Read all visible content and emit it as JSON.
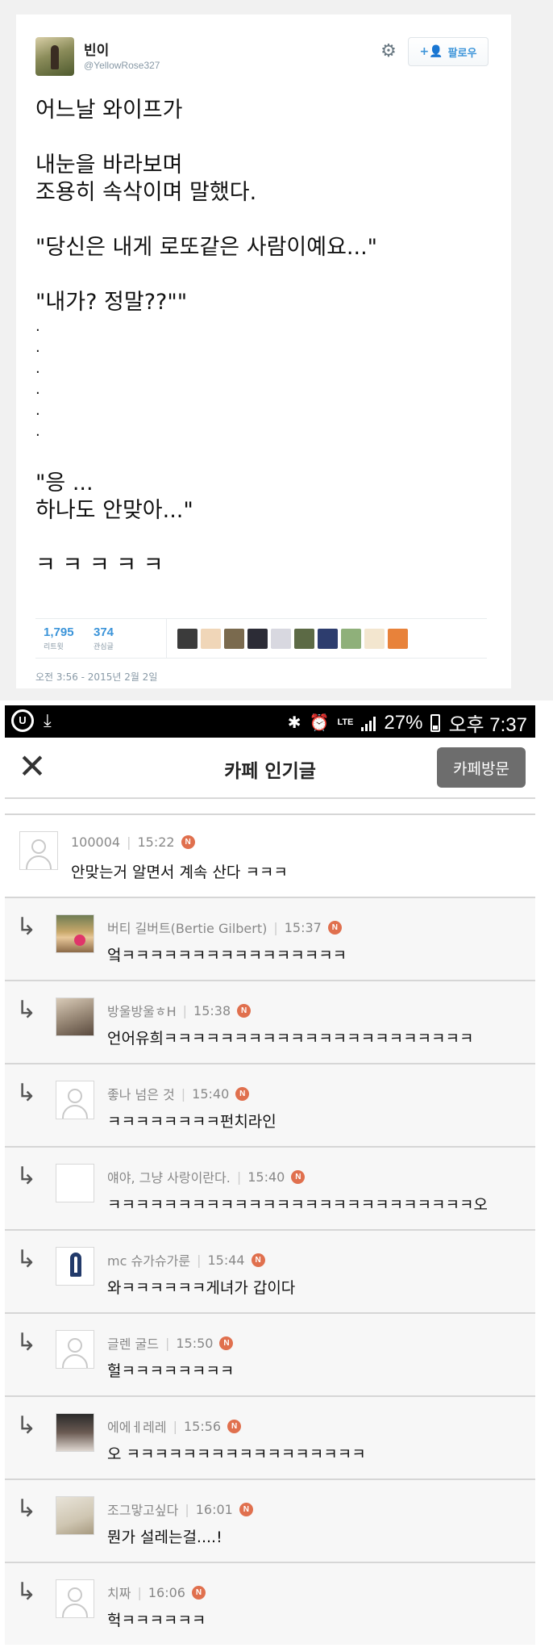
{
  "tweet": {
    "name": "빈이",
    "handle": "@YellowRose327",
    "follow_label": "팔로우",
    "lines": [
      "어느날 와이프가",
      "",
      "내눈을 바라보며",
      "조용히 속삭이며 말했다.",
      "",
      "\"당신은 내게 로또같은 사람이예요...\"",
      "",
      "\"내가? 정말??\"\"",
      ".",
      ".",
      ".",
      ".",
      ".",
      ".",
      "",
      "\"응 ...",
      "하나도 안맞아...\"",
      "",
      "ㅋ ㅋ ㅋ ㅋ ㅋ"
    ],
    "retweets_count": "1,795",
    "retweets_label": "리트윗",
    "likes_count": "374",
    "likes_label": "관심글",
    "timestamp": "오전 3:56 - 2015년 2월 2일",
    "face_colors": [
      "#3b3b3b",
      "#f0d6b8",
      "#7a6a4e",
      "#2c2c36",
      "#d8d8e0",
      "#5c6a45",
      "#2d3d6e",
      "#8fb07a",
      "#f3e6cf",
      "#e8823a"
    ]
  },
  "status_bar": {
    "battery": "27%",
    "time": "오후 7:37",
    "network": "LTE"
  },
  "app_bar": {
    "title": "카페 인기글",
    "visit_label": "카페방문"
  },
  "comments": [
    {
      "author": "100004",
      "time": "15:22",
      "text": "안맞는거 알면서 계속 산다 ㅋㅋㅋ",
      "reply": false,
      "avatar": "default"
    },
    {
      "author": "버티 길버트(Bertie Gilbert)",
      "time": "15:37",
      "text": "엌ㅋㅋㅋㅋㅋㅋㅋㅋㅋㅋㅋㅋㅋㅋㅋㅋ",
      "reply": true,
      "avatar": "bertie"
    },
    {
      "author": "방울방울ㅎH",
      "time": "15:38",
      "text": "언어유희ㅋㅋㅋㅋㅋㅋㅋㅋㅋㅋㅋㅋㅋㅋㅋㅋㅋㅋㅋㅋㅋㅋ",
      "reply": true,
      "avatar": "dog"
    },
    {
      "author": "좋나 넘은 것",
      "time": "15:40",
      "text": "ㅋㅋㅋㅋㅋㅋㅋㅋ펀치라인",
      "reply": true,
      "avatar": "default"
    },
    {
      "author": "얘야, 그냥 사랑이란다.",
      "time": "15:40",
      "text": "ㅋㅋㅋㅋㅋㅋㅋㅋㅋㅋㅋㅋㅋㅋㅋㅋㅋㅋㅋㅋㅋㅋㅋㅋㅋㅋ오",
      "reply": true,
      "avatar": "blank"
    },
    {
      "author": "mc 슈가슈가룬",
      "time": "15:44",
      "text": "와ㅋㅋㅋㅋㅋㅋ게녀가 갑이다",
      "reply": true,
      "avatar": "ribbon"
    },
    {
      "author": "글렌 굴드",
      "time": "15:50",
      "text": "헐ㅋㅋㅋㅋㅋㅋㅋㅋ",
      "reply": true,
      "avatar": "default"
    },
    {
      "author": "에에ㅔ레레",
      "time": "15:56",
      "text": "오 ㅋㅋㅋㅋㅋㅋㅋㅋㅋㅋㅋㅋㅋㅋㅋㅋㅋ",
      "reply": true,
      "avatar": "woman"
    },
    {
      "author": "조그맣고싶다",
      "time": "16:01",
      "text": "뭔가 설레는걸....!",
      "reply": true,
      "avatar": "puppy"
    },
    {
      "author": "치짜",
      "time": "16:06",
      "text": "헉ㅋㅋㅋㅋㅋㅋ",
      "reply": true,
      "avatar": "default"
    }
  ],
  "new_badge": "N"
}
